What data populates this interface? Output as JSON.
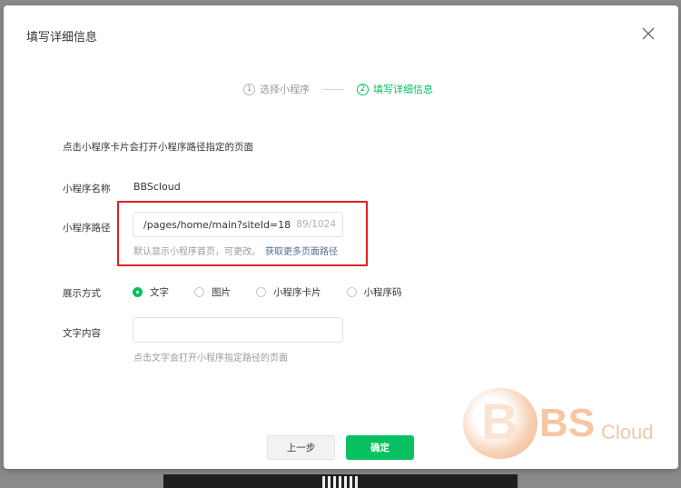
{
  "dialog": {
    "title": "填写详细信息",
    "steps": [
      {
        "num": "1",
        "label": "选择小程序"
      },
      {
        "num": "2",
        "label": "填写详细信息"
      }
    ],
    "description": "点击小程序卡片会打开小程序路径指定的页面",
    "name_label": "小程序名称",
    "name_value": "BBScloud",
    "path_label": "小程序路径",
    "path_value": "/pages/home/main?siteId=18",
    "path_counter": "89/1024",
    "path_hint": "默认显示小程序首页，可更改。",
    "path_link": "获取更多页面路径",
    "display_label": "展示方式",
    "display_options": [
      {
        "label": "文字",
        "checked": true
      },
      {
        "label": "图片",
        "checked": false
      },
      {
        "label": "小程序卡片",
        "checked": false
      },
      {
        "label": "小程序码",
        "checked": false
      }
    ],
    "text_label": "文字内容",
    "text_value": "",
    "text_hint": "点击文字会打开小程序指定路径的页面",
    "prev_button": "上一步",
    "ok_button": "确定"
  },
  "watermark": {
    "b": "B",
    "bs": "BS",
    "cloud": "Cloud"
  },
  "colors": {
    "accent": "#07c160",
    "link": "#576b95",
    "highlight": "#e02020"
  }
}
